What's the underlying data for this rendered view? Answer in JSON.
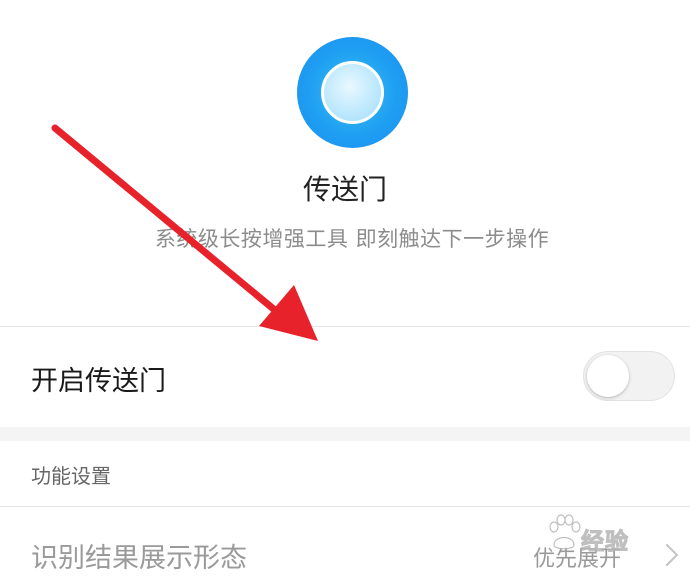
{
  "header": {
    "title": "传送门",
    "subtitle": "系统级长按增强工具 即刻触达下一步操作",
    "logo_icon": "portal-logo-icon",
    "logo_colors": {
      "outer": "#1e9ff2",
      "inner": "#bfe9fd"
    }
  },
  "toggle": {
    "label": "开启传送门",
    "state": "off"
  },
  "section": {
    "title": "功能设置"
  },
  "settings": [
    {
      "label": "识别结果展示形态",
      "value": "优先展开",
      "icon": "chevron-right-icon"
    }
  ],
  "annotation": {
    "arrow_color": "#e8222a"
  },
  "watermark": {
    "text": "经验",
    "brand": "Baidu"
  }
}
